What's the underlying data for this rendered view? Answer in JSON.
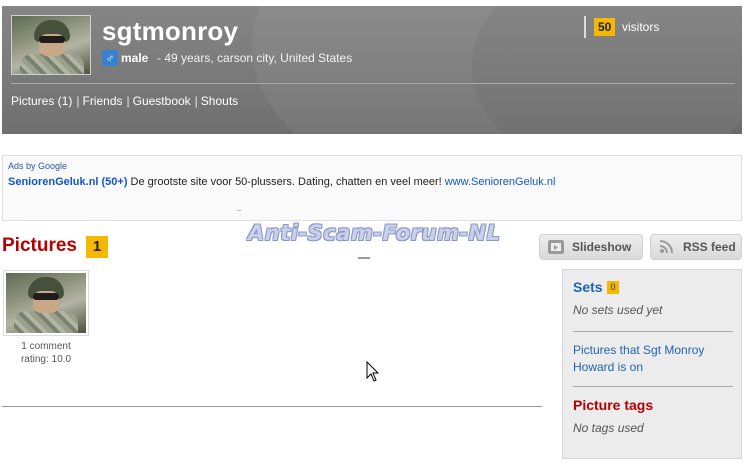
{
  "profile": {
    "username": "sgtmonroy",
    "gender_symbol": "♂",
    "gender": "male",
    "details": "- 49 years, carson city, United States",
    "visitors_count": "50",
    "visitors_label": "visitors"
  },
  "nav": [
    {
      "label": "Pictures (1)"
    },
    {
      "label": "Friends"
    },
    {
      "label": "Guestbook"
    },
    {
      "label": "Shouts"
    }
  ],
  "nav_separator": "|",
  "ads": {
    "ads_by": "Ads by Google",
    "title": "SeniorenGeluk.nl (50+)",
    "text": "De grootste site voor 50-plussers. Dating, chatten en veel meer!",
    "url": "www.SeniorenGeluk.nl"
  },
  "watermark": "Anti-Scam-Forum-NL",
  "pictures": {
    "title": "Pictures",
    "count": "1",
    "slideshow_label": "Slideshow",
    "rss_label": "RSS feed",
    "items": [
      {
        "comments": "1 comment",
        "rating": "rating: 10.0"
      }
    ]
  },
  "sidebar": {
    "sets_title": "Sets",
    "sets_count": "0",
    "sets_empty": "No sets used yet",
    "tagged_link": "Pictures that Sgt Monroy Howard is on",
    "tags_title": "Picture tags",
    "tags_empty": "No tags used"
  },
  "colors": {
    "header_bg": "#7a7a7a",
    "accent_yellow": "#f5b800",
    "title_red": "#b60000",
    "link_blue": "#1f63b5"
  },
  "icons": {
    "gender": "male-symbol-icon",
    "slideshow": "slideshow-icon",
    "rss": "rss-icon",
    "cursor": "mouse-cursor-icon"
  }
}
